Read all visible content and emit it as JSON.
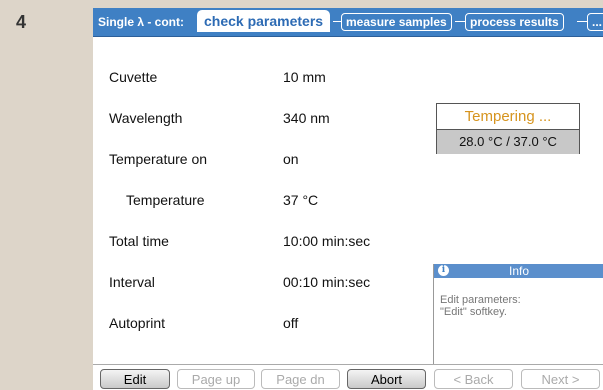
{
  "step_number": "4",
  "titlebar": {
    "mode": "Single λ - cont:",
    "active_tab": "check parameters",
    "tabs": [
      "measure samples",
      "process results",
      "..."
    ]
  },
  "parameters": [
    {
      "label": "Cuvette",
      "value": "10 mm"
    },
    {
      "label": "Wavelength",
      "value": "340 nm"
    },
    {
      "label": "Temperature on",
      "value": "on"
    },
    {
      "label": "Temperature",
      "value": "37 °C"
    },
    {
      "label": "Total time",
      "value": "10:00 min:sec"
    },
    {
      "label": "Interval",
      "value": "00:10 min:sec"
    },
    {
      "label": "Autoprint",
      "value": "off"
    }
  ],
  "tempering": {
    "title": "Tempering ...",
    "readout": "28.0 °C / 37.0 °C",
    "title_color": "#d6941e"
  },
  "info": {
    "icon": "info-icon",
    "title": "Info",
    "lines": [
      "Edit parameters:",
      "\"Edit\" softkey."
    ]
  },
  "softkeys": [
    {
      "label": "Edit",
      "enabled": true
    },
    {
      "label": "Page up",
      "enabled": false
    },
    {
      "label": "Page dn",
      "enabled": false
    },
    {
      "label": "Abort",
      "enabled": true
    },
    {
      "label": "< Back",
      "enabled": false
    },
    {
      "label": "Next >",
      "enabled": false
    }
  ],
  "colors": {
    "titlebar": "#3f80c4",
    "background": "#ddd5c9"
  }
}
